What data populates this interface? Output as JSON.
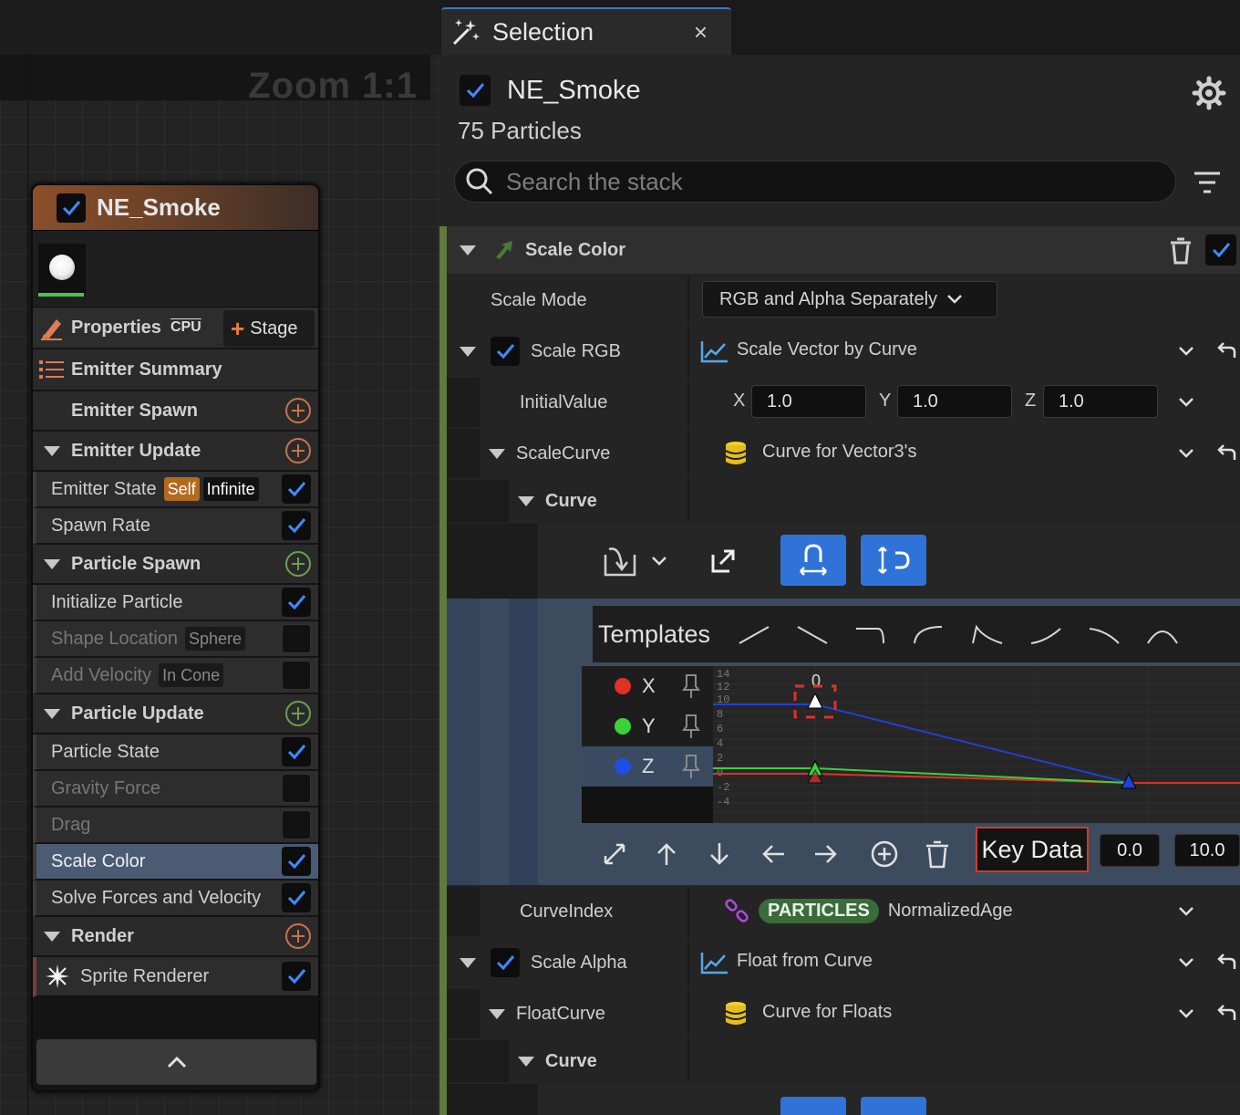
{
  "graph": {
    "zoom_label": "Zoom 1:1"
  },
  "node": {
    "title": "NE_Smoke",
    "properties_label": "Properties",
    "cpu_badge": "CPU",
    "stage_label": "Stage",
    "emitter_summary": "Emitter Summary",
    "emitter_spawn": "Emitter Spawn",
    "emitter_update": "Emitter Update",
    "emitter_state": "Emitter State",
    "self_tag": "Self",
    "infinite_tag": "Infinite",
    "spawn_rate": "Spawn Rate",
    "particle_spawn": "Particle Spawn",
    "initialize_particle": "Initialize Particle",
    "shape_location": "Shape Location",
    "sphere_tag": "Sphere",
    "add_velocity": "Add Velocity",
    "in_cone_tag": "In Cone",
    "particle_update": "Particle Update",
    "particle_state": "Particle State",
    "gravity_force": "Gravity Force",
    "drag": "Drag",
    "scale_color": "Scale Color",
    "solve_forces": "Solve Forces and Velocity",
    "render": "Render",
    "sprite_renderer": "Sprite Renderer"
  },
  "panel": {
    "tab_title": "Selection",
    "tab_close": "×",
    "emitter_name": "NE_Smoke",
    "particle_count": "75 Particles",
    "search_placeholder": "Search the stack",
    "module_title": "Scale Color",
    "scale_mode_label": "Scale Mode",
    "scale_mode_value": "RGB and Alpha Separately",
    "scale_rgb_label": "Scale RGB",
    "scale_rgb_value": "Scale Vector by Curve",
    "initial_value_label": "InitialValue",
    "x_label": "X",
    "x_value": "1.0",
    "y_label": "Y",
    "y_value": "1.0",
    "z_label": "Z",
    "z_value": "1.0",
    "scale_curve_label": "ScaleCurve",
    "scale_curve_value": "Curve for Vector3's",
    "curve_label": "Curve",
    "templates_label": "Templates",
    "channels": [
      {
        "label": "X",
        "color": "#e0302a"
      },
      {
        "label": "Y",
        "color": "#3ad13a"
      },
      {
        "label": "Z",
        "color": "#1f4fe0"
      }
    ],
    "key_data_label": "Key Data",
    "key_time": "0.0",
    "key_value": "10.0",
    "curve_index_label": "CurveIndex",
    "particles_pill": "PARTICLES",
    "normalized_age": "NormalizedAge",
    "scale_alpha_label": "Scale Alpha",
    "scale_alpha_value": "Float from Curve",
    "float_curve_label": "FloatCurve",
    "float_curve_value": "Curve for Floats",
    "curve_label_2": "Curve",
    "axis_ticks_top": "0"
  },
  "colors": {
    "accent_blue": "#2f73d8",
    "section_green": "#5e7a3e",
    "key_highlight": "#d03a2a"
  }
}
